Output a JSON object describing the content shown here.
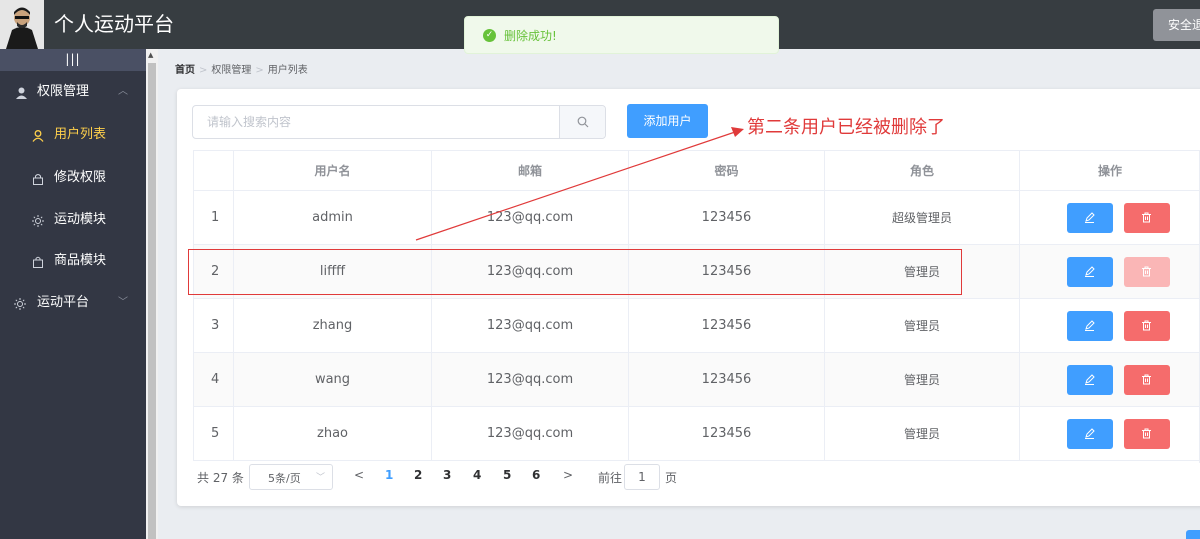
{
  "header": {
    "app_title": "个人运动平台",
    "logout_label": "安全退出"
  },
  "toast": {
    "message": "删除成功!",
    "type": "success"
  },
  "sidebar": {
    "toggle_label": "|||",
    "menus": [
      {
        "label": "权限管理",
        "icon": "user-icon",
        "expanded": true
      },
      {
        "label": "用户列表",
        "icon": "person-icon",
        "active": true
      },
      {
        "label": "修改权限",
        "icon": "lock-icon"
      },
      {
        "label": "运动模块",
        "icon": "sun-icon"
      },
      {
        "label": "商品模块",
        "icon": "shopping-bag-icon"
      },
      {
        "label": "运动平台",
        "icon": "sun-icon",
        "expanded": false
      }
    ]
  },
  "breadcrumb": [
    "首页",
    "权限管理",
    "用户列表"
  ],
  "search": {
    "placeholder": "请输入搜索内容",
    "value": ""
  },
  "add_user_label": "添加用户",
  "annotation": "第二条用户已经被删除了",
  "table": {
    "columns": [
      "",
      "用户名",
      "邮箱",
      "密码",
      "角色",
      "操作"
    ],
    "rows": [
      {
        "index": "1",
        "username": "admin",
        "email": "123@qq.com",
        "password": "123456",
        "role": "超级管理员"
      },
      {
        "index": "2",
        "username": "liffff",
        "email": "123@qq.com",
        "password": "123456",
        "role": "管理员"
      },
      {
        "index": "3",
        "username": "zhang",
        "email": "123@qq.com",
        "password": "123456",
        "role": "管理员"
      },
      {
        "index": "4",
        "username": "wang",
        "email": "123@qq.com",
        "password": "123456",
        "role": "管理员"
      },
      {
        "index": "5",
        "username": "zhao",
        "email": "123@qq.com",
        "password": "123456",
        "role": "管理员"
      }
    ]
  },
  "pagination": {
    "total_label": "共 27 条",
    "page_size": "5条/页",
    "pages": [
      "1",
      "2",
      "3",
      "4",
      "5",
      "6"
    ],
    "current_page": "1",
    "goto_label": "前往",
    "goto_value": "1",
    "goto_unit": "页",
    "prev": "<",
    "next": ">"
  },
  "colors": {
    "header_bg": "#373d41",
    "sidebar_bg": "#333744",
    "primary": "#409eff",
    "danger": "#f56c6c",
    "active_menu": "#ffd04b",
    "success": "#67c23a",
    "annotation": "#e03a3a"
  }
}
